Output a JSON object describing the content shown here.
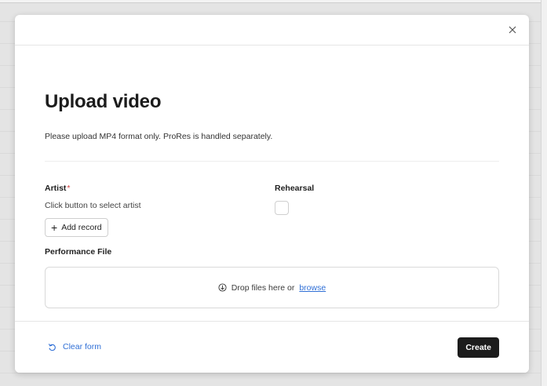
{
  "modal": {
    "title": "Upload video",
    "subtitle": "Please upload MP4 format only. ProRes is handled separately."
  },
  "form": {
    "artist": {
      "label": "Artist",
      "required_marker": "*",
      "help": "Click button to select artist",
      "add_button_icon": "+",
      "add_button_label": "Add record"
    },
    "rehearsal": {
      "label": "Rehearsal",
      "checked": false
    },
    "performance_file": {
      "label": "Performance File",
      "drop_text": "Drop files here or",
      "browse_label": "browse"
    }
  },
  "footer": {
    "clear_label": "Clear form",
    "create_label": "Create"
  },
  "icons": {
    "close": "close-icon",
    "upload": "upload-icon",
    "clear": "undo-icon",
    "add": "plus-icon"
  },
  "colors": {
    "accent": "#2f6fd6",
    "required": "#d23a3a",
    "primary_button": "#1c1c1c"
  }
}
